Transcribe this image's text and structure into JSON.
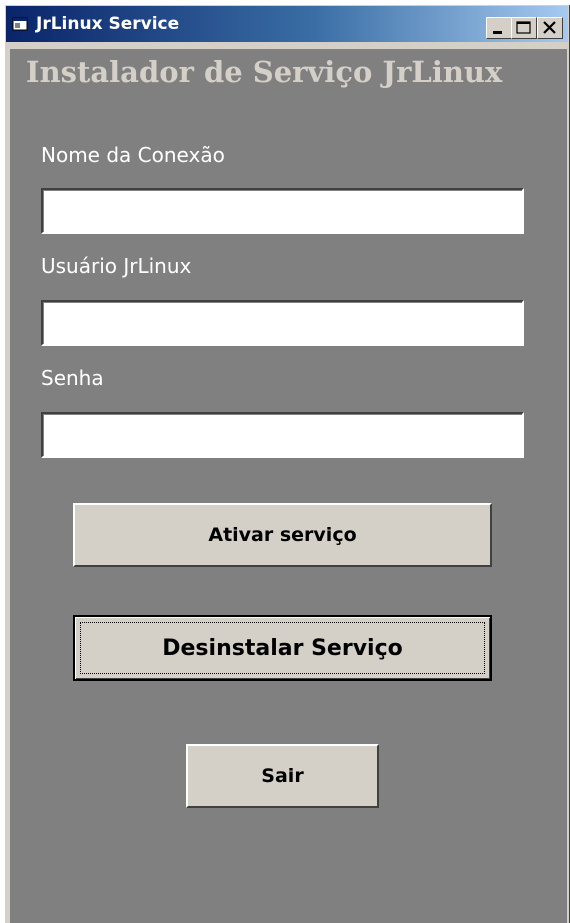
{
  "window": {
    "title": "JrLinux Service",
    "titlebar_colors": [
      "#0a246a",
      "#a6caf0"
    ]
  },
  "form": {
    "heading": "Instalador de Serviço JrLinux",
    "connection_name_label": "Nome da Conexão",
    "connection_name_value": "",
    "user_label": "Usuário JrLinux",
    "user_value": "",
    "password_label": "Senha",
    "password_value": ""
  },
  "buttons": {
    "activate_label": "Ativar serviço",
    "uninstall_label": "Desinstalar Serviço",
    "exit_label": "Sair"
  },
  "colors": {
    "client_background": "#808080",
    "heading_color": "#d4d0c8",
    "label_color": "#ffffff",
    "button_face": "#d4d0c8"
  },
  "icons": [
    "app-icon",
    "minimize-icon",
    "maximize-icon",
    "close-icon"
  ]
}
